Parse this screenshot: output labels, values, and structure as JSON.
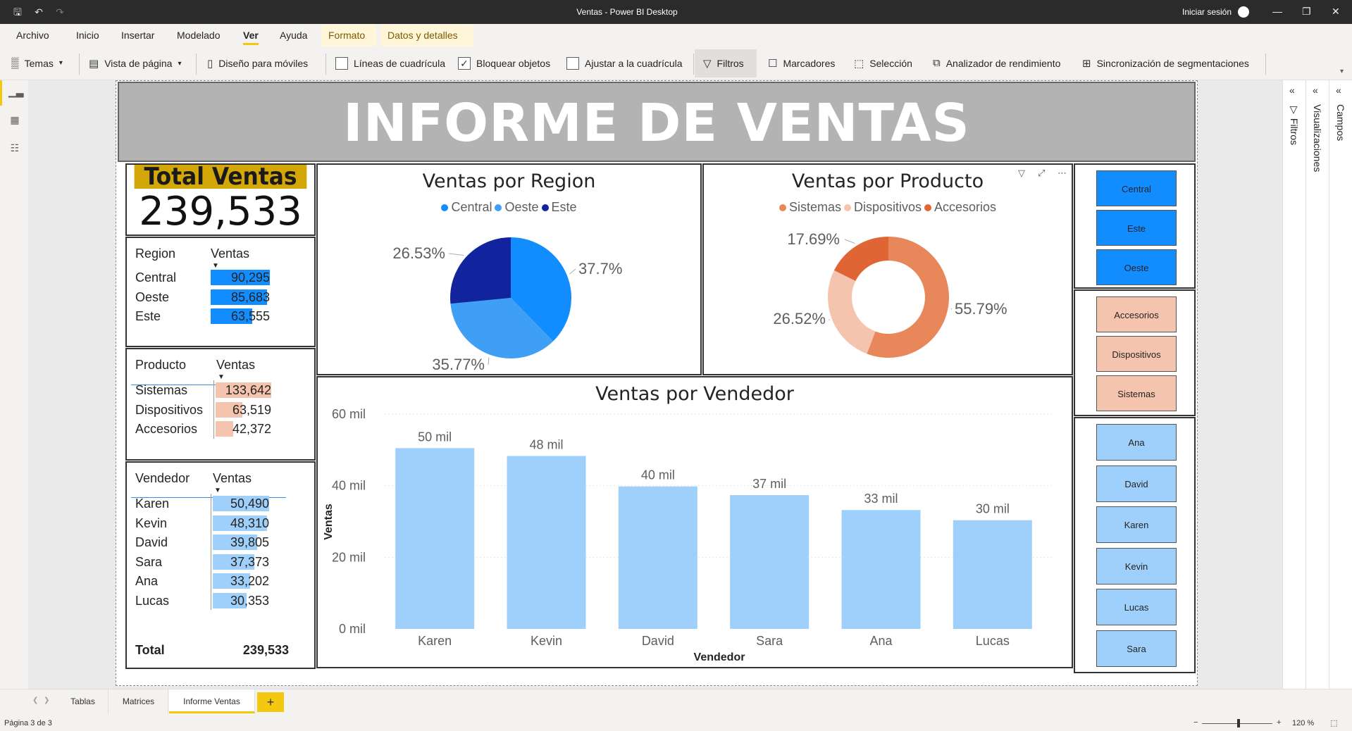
{
  "window": {
    "title": "Ventas - Power BI Desktop",
    "signin": "Iniciar sesión"
  },
  "menu": [
    "Archivo",
    "Inicio",
    "Insertar",
    "Modelado",
    "Ver",
    "Ayuda",
    "Formato",
    "Datos y detalles"
  ],
  "toolbar": {
    "temas": "Temas",
    "vista_pagina": "Vista de página",
    "diseno_moviles": "Diseño para móviles",
    "lineas_cuadricula": "Líneas de cuadrícula",
    "bloquear_objetos": "Bloquear objetos",
    "ajustar_cuadricula": "Ajustar a la cuadrícula",
    "filtros": "Filtros",
    "marcadores": "Marcadores",
    "seleccion": "Selección",
    "analizador": "Analizador de rendimiento",
    "sincronizacion": "Sincronización de segmentaciones"
  },
  "report": {
    "banner_title": "INFORME DE VENTAS",
    "card": {
      "title": "Total Ventas",
      "value": "239,533"
    },
    "region_table": {
      "col1": "Region",
      "col2": "Ventas",
      "rows": [
        {
          "label": "Central",
          "value": "90,295",
          "num": 90295
        },
        {
          "label": "Oeste",
          "value": "85,683",
          "num": 85683
        },
        {
          "label": "Este",
          "value": "63,555",
          "num": 63555
        }
      ]
    },
    "producto_table": {
      "col1": "Producto",
      "col2": "Ventas",
      "rows": [
        {
          "label": "Sistemas",
          "value": "133,642",
          "num": 133642
        },
        {
          "label": "Dispositivos",
          "value": "63,519",
          "num": 63519
        },
        {
          "label": "Accesorios",
          "value": "42,372",
          "num": 42372
        }
      ]
    },
    "vendedor_table": {
      "col1": "Vendedor",
      "col2": "Ventas",
      "rows": [
        {
          "label": "Karen",
          "value": "50,490",
          "num": 50490
        },
        {
          "label": "Kevin",
          "value": "48,310",
          "num": 48310
        },
        {
          "label": "David",
          "value": "39,805",
          "num": 39805
        },
        {
          "label": "Sara",
          "value": "37,373",
          "num": 37373
        },
        {
          "label": "Ana",
          "value": "33,202",
          "num": 33202
        },
        {
          "label": "Lucas",
          "value": "30,353",
          "num": 30353
        }
      ],
      "total_label": "Total",
      "total_value": "239,533"
    },
    "slicers": {
      "region": [
        "Central",
        "Este",
        "Oeste"
      ],
      "producto": [
        "Accesorios",
        "Dispositivos",
        "Sistemas"
      ],
      "vendedor": [
        "Ana",
        "David",
        "Karen",
        "Kevin",
        "Lucas",
        "Sara"
      ]
    }
  },
  "colors": {
    "region": {
      "Central": "#118dff",
      "Oeste": "#3f9ff5",
      "Este": "#12239e"
    },
    "producto": {
      "Sistemas": "#e8875a",
      "Dispositivos": "#f4c4ae",
      "Accesorios": "#e06534"
    },
    "vendedor_bar": "#9fd0fc",
    "region_slicer": "#118dff",
    "producto_slicer": "#f4c4ae",
    "vendedor_slicer": "#9fd0fc"
  },
  "chart_data": [
    {
      "type": "pie",
      "title": "Ventas por Region",
      "categories": [
        "Central",
        "Oeste",
        "Este"
      ],
      "values": [
        37.7,
        35.77,
        26.53
      ],
      "labels": [
        "37.7%",
        "35.77%",
        "26.53%"
      ]
    },
    {
      "type": "pie",
      "donut": true,
      "title": "Ventas por Producto",
      "categories": [
        "Sistemas",
        "Dispositivos",
        "Accesorios"
      ],
      "values": [
        55.79,
        26.52,
        17.69
      ],
      "labels": [
        "55.79%",
        "26.52%",
        "17.69%"
      ]
    },
    {
      "type": "bar",
      "title": "Ventas por Vendedor",
      "categories": [
        "Karen",
        "Kevin",
        "David",
        "Sara",
        "Ana",
        "Lucas"
      ],
      "values": [
        50490,
        48310,
        39805,
        37373,
        33202,
        30353
      ],
      "data_labels": [
        "50 mil",
        "48 mil",
        "40 mil",
        "37 mil",
        "33 mil",
        "30 mil"
      ],
      "xlabel": "Vendedor",
      "ylabel": "Ventas",
      "yticks": [
        "0 mil",
        "20 mil",
        "40 mil",
        "60 mil"
      ],
      "ylim": [
        0,
        60000
      ],
      "grid": true
    }
  ],
  "pages": [
    "Tablas",
    "Matrices",
    "Informe Ventas"
  ],
  "panes": [
    "Filtros",
    "Visualizaciones",
    "Campos"
  ],
  "status": {
    "page": "Página 3 de 3",
    "zoom": "120 %"
  }
}
